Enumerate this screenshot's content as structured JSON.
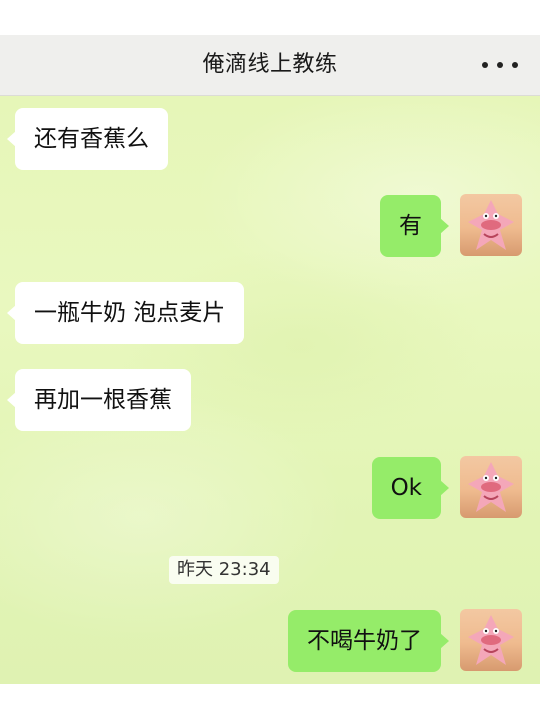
{
  "header": {
    "title": "俺滴线上教练",
    "more_icon": "more-dots-icon"
  },
  "messages": [
    {
      "side": "left",
      "text": "还有香蕉么"
    },
    {
      "side": "right",
      "text": "有",
      "avatar": "patrick-star-avatar"
    },
    {
      "side": "left",
      "text": "一瓶牛奶  泡点麦片"
    },
    {
      "side": "left",
      "text": "再加一根香蕉"
    },
    {
      "side": "right",
      "text": "Ok",
      "avatar": "patrick-star-avatar"
    },
    {
      "side": "right",
      "text": "不喝牛奶了",
      "avatar": "patrick-star-avatar"
    }
  ],
  "timestamp": "昨天 23:34",
  "colors": {
    "nav_bg": "#efefed",
    "outgoing_bubble": "#95ec69",
    "incoming_bubble": "#ffffff",
    "chat_bg": "#e6f6b8"
  }
}
